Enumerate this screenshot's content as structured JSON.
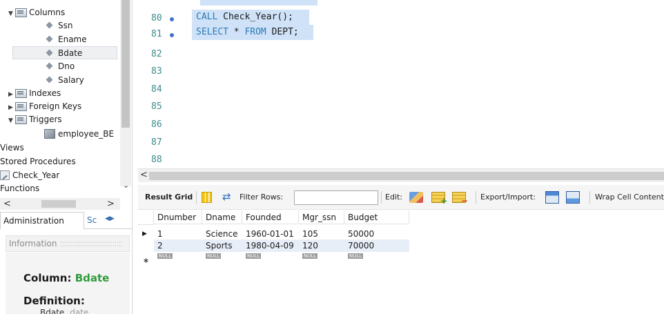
{
  "navigator": {
    "tree": {
      "columns_label": "Columns",
      "columns": [
        "Ssn",
        "Ename",
        "Bdate",
        "Dno",
        "Salary"
      ],
      "indexes_label": "Indexes",
      "foreign_keys_label": "Foreign Keys",
      "triggers_label": "Triggers",
      "trigger_item": "employee_BE",
      "views_label": "Views",
      "stored_procedures_label": "Stored Procedures",
      "procedure_item": "Check_Year",
      "functions_label": "Functions"
    },
    "tabs": {
      "administration": "Administration",
      "schemas": "Sc"
    },
    "info_header": "Information",
    "column_prefix": "Column:",
    "column_name": "Bdate",
    "definition_label": "Definition:",
    "definition_name": "Bdate",
    "definition_type": "date"
  },
  "editor": {
    "lines": [
      {
        "num": "80",
        "kw": "CALL",
        "rest": " Check_Year();"
      },
      {
        "num": "81",
        "kw": "SELECT",
        "rest": " * ",
        "kw2": "FROM",
        "rest2": " DEPT;"
      },
      {
        "num": "82"
      },
      {
        "num": "83"
      },
      {
        "num": "84"
      },
      {
        "num": "85"
      },
      {
        "num": "86"
      },
      {
        "num": "87"
      },
      {
        "num": "88"
      }
    ]
  },
  "toolbar": {
    "result_grid": "Result Grid",
    "filter_rows": "Filter Rows:",
    "edit": "Edit:",
    "export_import": "Export/Import:",
    "wrap_cell": "Wrap Cell Content"
  },
  "grid": {
    "columns": [
      "Dnumber",
      "Dname",
      "Founded",
      "Mgr_ssn",
      "Budget"
    ],
    "rows": [
      [
        "1",
        "Science",
        "1960-01-01",
        "105",
        "50000"
      ],
      [
        "2",
        "Sports",
        "1980-04-09",
        "120",
        "70000"
      ]
    ],
    "null_label": "NULL"
  },
  "colors": {
    "selection": "#cfe2f7",
    "keyword": "#2a7ab8",
    "line_number": "#3e8a8a",
    "column_name": "#2f9a3a"
  }
}
